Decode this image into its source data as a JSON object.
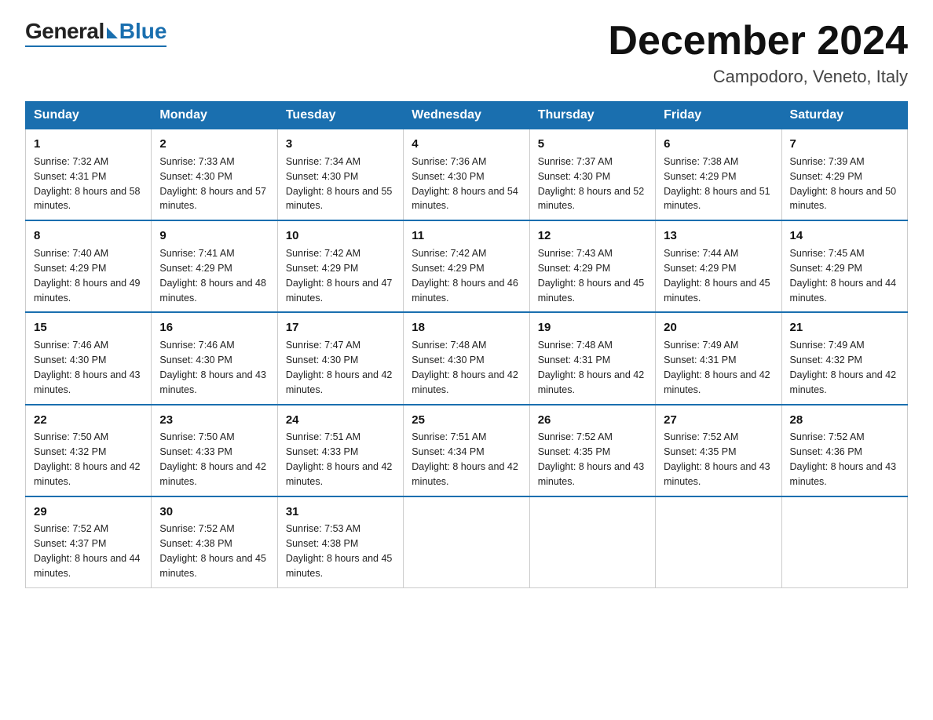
{
  "logo": {
    "general": "General",
    "blue": "Blue"
  },
  "header": {
    "month": "December 2024",
    "location": "Campodoro, Veneto, Italy"
  },
  "days_of_week": [
    "Sunday",
    "Monday",
    "Tuesday",
    "Wednesday",
    "Thursday",
    "Friday",
    "Saturday"
  ],
  "weeks": [
    [
      {
        "day": "1",
        "sunrise": "7:32 AM",
        "sunset": "4:31 PM",
        "daylight": "8 hours and 58 minutes."
      },
      {
        "day": "2",
        "sunrise": "7:33 AM",
        "sunset": "4:30 PM",
        "daylight": "8 hours and 57 minutes."
      },
      {
        "day": "3",
        "sunrise": "7:34 AM",
        "sunset": "4:30 PM",
        "daylight": "8 hours and 55 minutes."
      },
      {
        "day": "4",
        "sunrise": "7:36 AM",
        "sunset": "4:30 PM",
        "daylight": "8 hours and 54 minutes."
      },
      {
        "day": "5",
        "sunrise": "7:37 AM",
        "sunset": "4:30 PM",
        "daylight": "8 hours and 52 minutes."
      },
      {
        "day": "6",
        "sunrise": "7:38 AM",
        "sunset": "4:29 PM",
        "daylight": "8 hours and 51 minutes."
      },
      {
        "day": "7",
        "sunrise": "7:39 AM",
        "sunset": "4:29 PM",
        "daylight": "8 hours and 50 minutes."
      }
    ],
    [
      {
        "day": "8",
        "sunrise": "7:40 AM",
        "sunset": "4:29 PM",
        "daylight": "8 hours and 49 minutes."
      },
      {
        "day": "9",
        "sunrise": "7:41 AM",
        "sunset": "4:29 PM",
        "daylight": "8 hours and 48 minutes."
      },
      {
        "day": "10",
        "sunrise": "7:42 AM",
        "sunset": "4:29 PM",
        "daylight": "8 hours and 47 minutes."
      },
      {
        "day": "11",
        "sunrise": "7:42 AM",
        "sunset": "4:29 PM",
        "daylight": "8 hours and 46 minutes."
      },
      {
        "day": "12",
        "sunrise": "7:43 AM",
        "sunset": "4:29 PM",
        "daylight": "8 hours and 45 minutes."
      },
      {
        "day": "13",
        "sunrise": "7:44 AM",
        "sunset": "4:29 PM",
        "daylight": "8 hours and 45 minutes."
      },
      {
        "day": "14",
        "sunrise": "7:45 AM",
        "sunset": "4:29 PM",
        "daylight": "8 hours and 44 minutes."
      }
    ],
    [
      {
        "day": "15",
        "sunrise": "7:46 AM",
        "sunset": "4:30 PM",
        "daylight": "8 hours and 43 minutes."
      },
      {
        "day": "16",
        "sunrise": "7:46 AM",
        "sunset": "4:30 PM",
        "daylight": "8 hours and 43 minutes."
      },
      {
        "day": "17",
        "sunrise": "7:47 AM",
        "sunset": "4:30 PM",
        "daylight": "8 hours and 42 minutes."
      },
      {
        "day": "18",
        "sunrise": "7:48 AM",
        "sunset": "4:30 PM",
        "daylight": "8 hours and 42 minutes."
      },
      {
        "day": "19",
        "sunrise": "7:48 AM",
        "sunset": "4:31 PM",
        "daylight": "8 hours and 42 minutes."
      },
      {
        "day": "20",
        "sunrise": "7:49 AM",
        "sunset": "4:31 PM",
        "daylight": "8 hours and 42 minutes."
      },
      {
        "day": "21",
        "sunrise": "7:49 AM",
        "sunset": "4:32 PM",
        "daylight": "8 hours and 42 minutes."
      }
    ],
    [
      {
        "day": "22",
        "sunrise": "7:50 AM",
        "sunset": "4:32 PM",
        "daylight": "8 hours and 42 minutes."
      },
      {
        "day": "23",
        "sunrise": "7:50 AM",
        "sunset": "4:33 PM",
        "daylight": "8 hours and 42 minutes."
      },
      {
        "day": "24",
        "sunrise": "7:51 AM",
        "sunset": "4:33 PM",
        "daylight": "8 hours and 42 minutes."
      },
      {
        "day": "25",
        "sunrise": "7:51 AM",
        "sunset": "4:34 PM",
        "daylight": "8 hours and 42 minutes."
      },
      {
        "day": "26",
        "sunrise": "7:52 AM",
        "sunset": "4:35 PM",
        "daylight": "8 hours and 43 minutes."
      },
      {
        "day": "27",
        "sunrise": "7:52 AM",
        "sunset": "4:35 PM",
        "daylight": "8 hours and 43 minutes."
      },
      {
        "day": "28",
        "sunrise": "7:52 AM",
        "sunset": "4:36 PM",
        "daylight": "8 hours and 43 minutes."
      }
    ],
    [
      {
        "day": "29",
        "sunrise": "7:52 AM",
        "sunset": "4:37 PM",
        "daylight": "8 hours and 44 minutes."
      },
      {
        "day": "30",
        "sunrise": "7:52 AM",
        "sunset": "4:38 PM",
        "daylight": "8 hours and 45 minutes."
      },
      {
        "day": "31",
        "sunrise": "7:53 AM",
        "sunset": "4:38 PM",
        "daylight": "8 hours and 45 minutes."
      },
      null,
      null,
      null,
      null
    ]
  ]
}
